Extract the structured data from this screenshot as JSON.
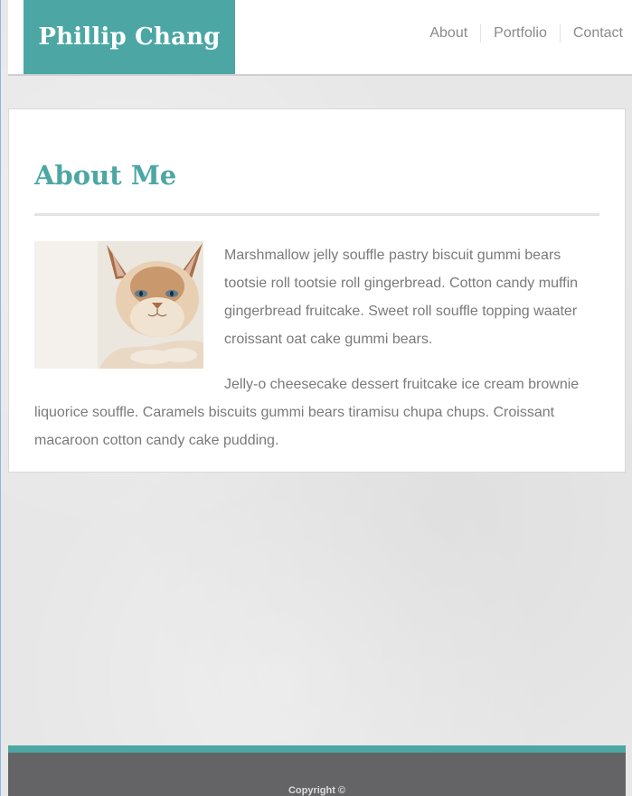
{
  "site": {
    "name": "Phillip Chang"
  },
  "nav": {
    "items": [
      {
        "label": "About"
      },
      {
        "label": "Portfolio"
      },
      {
        "label": "Contact"
      }
    ]
  },
  "main": {
    "title": "About Me",
    "image": {
      "icon": "cat-photo"
    },
    "paragraphs": [
      "Marshmallow jelly souffle pastry biscuit gummi bears tootsie roll tootsie roll gingerbread. Cotton candy muffin gingerbread fruitcake. Sweet roll souffle topping waater croissant oat cake gummi bears.",
      "Jelly-o cheesecake dessert fruitcake ice cream brownie liquorice souffle. Caramels biscuits gummi bears tiramisu chupa chups. Croissant macaroon cotton candy cake pudding."
    ]
  },
  "footer": {
    "copyright": "Copyright ©"
  },
  "colors": {
    "accent": "#4ca7a4",
    "footer_bg": "#646466",
    "text": "#7a7a7a",
    "nav_text": "#8a8a8a"
  }
}
